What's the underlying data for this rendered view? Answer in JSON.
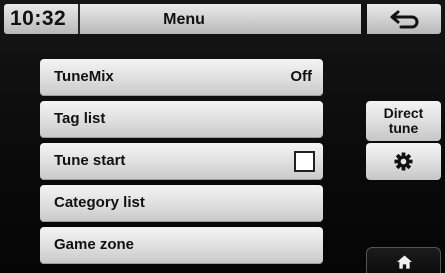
{
  "status_bar": {
    "clock": "10:32",
    "title": "Menu",
    "back_icon": "back-arrow-icon"
  },
  "menu": {
    "items": [
      {
        "label": "TuneMix",
        "value": "Off"
      },
      {
        "label": "Tag list"
      },
      {
        "label": "Tune start",
        "checked": false
      },
      {
        "label": "Category list"
      },
      {
        "label": "Game zone"
      }
    ]
  },
  "side": {
    "direct_tune_line1": "Direct",
    "direct_tune_line2": "tune",
    "settings_icon": "gear-icon",
    "home_icon": "home-icon"
  },
  "colors": {
    "background": "#0a0a0a",
    "button_light": "#e2e2e2",
    "text": "#111111"
  }
}
